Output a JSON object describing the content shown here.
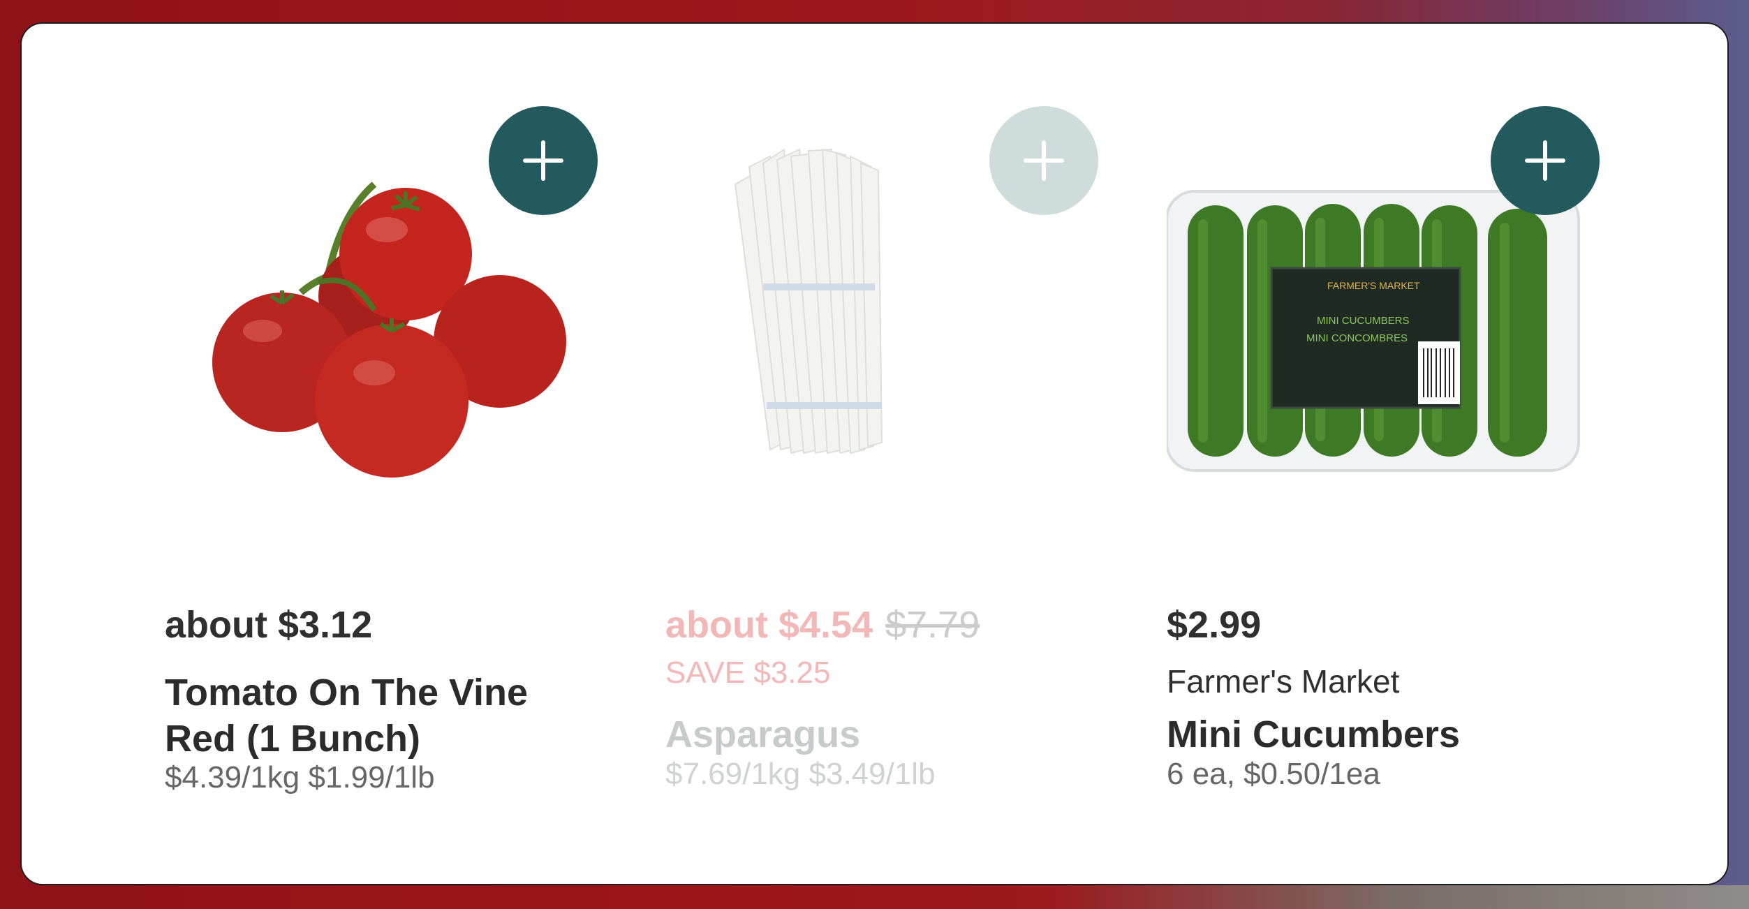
{
  "products": [
    {
      "price": "about $3.12",
      "name": "Tomato On The Vine Red (1 Bunch)",
      "unit_price": "$4.39/1kg $1.99/1lb",
      "image": "tomato-on-vine-image",
      "add_icon": "plus-icon"
    },
    {
      "price": "about $4.54",
      "original_price": "$7.79",
      "savings": "SAVE $3.25",
      "name": "Asparagus",
      "unit_price": "$7.69/1kg $3.49/1lb",
      "image": "white-asparagus-image",
      "add_icon": "plus-icon",
      "state": "unavailable"
    },
    {
      "price": "$2.99",
      "brand": "Farmer's Market",
      "name": "Mini Cucumbers",
      "unit_price": "6 ea, $0.50/1ea",
      "image": "mini-cucumbers-image",
      "add_icon": "plus-icon",
      "package_text": [
        "FARMER'S MARKET",
        "MINI CUCUMBERS",
        "MINI CONCOMBRES"
      ]
    }
  ],
  "colors": {
    "add_button": "#235a5e",
    "add_button_disabled": "#cfdcdc",
    "sale_price": "#f2b7b7"
  }
}
